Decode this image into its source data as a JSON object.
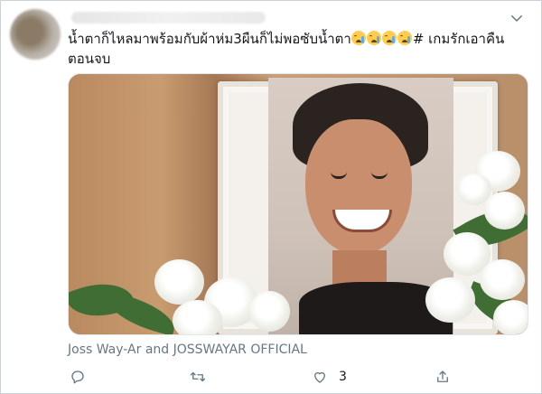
{
  "tweet": {
    "text_main": "น้ำตาก็ไหลมาพร้อมกับผ้าห่ม3ผืนก็ไม่พอซับน้ำตา",
    "hashtag": "# เกมรักเอาคืนตอนจบ",
    "emoji_count": 4,
    "emoji_name": "loudly-crying-face"
  },
  "media": {
    "credit": "Joss Way-Ar and JOSSWAYAR OFFICIAL"
  },
  "actions": {
    "reply_icon": "reply-icon",
    "retweet_icon": "retweet-icon",
    "like_icon": "heart-icon",
    "like_count": "3",
    "share_icon": "share-icon"
  },
  "colors": {
    "text": "#14171a",
    "secondary": "#657786",
    "border": "#c9d2d8"
  }
}
